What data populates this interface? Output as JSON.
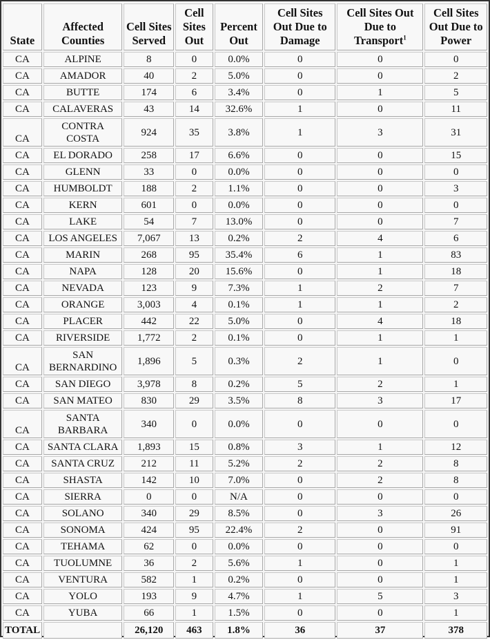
{
  "table": {
    "headers": [
      "State",
      "Affected Counties",
      "Cell Sites Served",
      "Cell Sites Out",
      "Percent Out",
      "Cell Sites Out Due to Damage",
      "Cell Sites Out Due to Transport",
      "Cell Sites Out Due to Power"
    ],
    "transport_footnote": "1",
    "rows": [
      [
        "CA",
        "ALPINE",
        "8",
        "0",
        "0.0%",
        "0",
        "0",
        "0"
      ],
      [
        "CA",
        "AMADOR",
        "40",
        "2",
        "5.0%",
        "0",
        "0",
        "2"
      ],
      [
        "CA",
        "BUTTE",
        "174",
        "6",
        "3.4%",
        "0",
        "1",
        "5"
      ],
      [
        "CA",
        "CALAVERAS",
        "43",
        "14",
        "32.6%",
        "1",
        "0",
        "11"
      ],
      [
        "CA",
        "CONTRA COSTA",
        "924",
        "35",
        "3.8%",
        "1",
        "3",
        "31"
      ],
      [
        "CA",
        "EL DORADO",
        "258",
        "17",
        "6.6%",
        "0",
        "0",
        "15"
      ],
      [
        "CA",
        "GLENN",
        "33",
        "0",
        "0.0%",
        "0",
        "0",
        "0"
      ],
      [
        "CA",
        "HUMBOLDT",
        "188",
        "2",
        "1.1%",
        "0",
        "0",
        "3"
      ],
      [
        "CA",
        "KERN",
        "601",
        "0",
        "0.0%",
        "0",
        "0",
        "0"
      ],
      [
        "CA",
        "LAKE",
        "54",
        "7",
        "13.0%",
        "0",
        "0",
        "7"
      ],
      [
        "CA",
        "LOS ANGELES",
        "7,067",
        "13",
        "0.2%",
        "2",
        "4",
        "6"
      ],
      [
        "CA",
        "MARIN",
        "268",
        "95",
        "35.4%",
        "6",
        "1",
        "83"
      ],
      [
        "CA",
        "NAPA",
        "128",
        "20",
        "15.6%",
        "0",
        "1",
        "18"
      ],
      [
        "CA",
        "NEVADA",
        "123",
        "9",
        "7.3%",
        "1",
        "2",
        "7"
      ],
      [
        "CA",
        "ORANGE",
        "3,003",
        "4",
        "0.1%",
        "1",
        "1",
        "2"
      ],
      [
        "CA",
        "PLACER",
        "442",
        "22",
        "5.0%",
        "0",
        "4",
        "18"
      ],
      [
        "CA",
        "RIVERSIDE",
        "1,772",
        "2",
        "0.1%",
        "0",
        "1",
        "1"
      ],
      [
        "CA",
        "SAN BERNARDINO",
        "1,896",
        "5",
        "0.3%",
        "2",
        "1",
        "0"
      ],
      [
        "CA",
        "SAN DIEGO",
        "3,978",
        "8",
        "0.2%",
        "5",
        "2",
        "1"
      ],
      [
        "CA",
        "SAN MATEO",
        "830",
        "29",
        "3.5%",
        "8",
        "3",
        "17"
      ],
      [
        "CA",
        "SANTA BARBARA",
        "340",
        "0",
        "0.0%",
        "0",
        "0",
        "0"
      ],
      [
        "CA",
        "SANTA CLARA",
        "1,893",
        "15",
        "0.8%",
        "3",
        "1",
        "12"
      ],
      [
        "CA",
        "SANTA CRUZ",
        "212",
        "11",
        "5.2%",
        "2",
        "2",
        "8"
      ],
      [
        "CA",
        "SHASTA",
        "142",
        "10",
        "7.0%",
        "0",
        "2",
        "8"
      ],
      [
        "CA",
        "SIERRA",
        "0",
        "0",
        "N/A",
        "0",
        "0",
        "0"
      ],
      [
        "CA",
        "SOLANO",
        "340",
        "29",
        "8.5%",
        "0",
        "3",
        "26"
      ],
      [
        "CA",
        "SONOMA",
        "424",
        "95",
        "22.4%",
        "2",
        "0",
        "91"
      ],
      [
        "CA",
        "TEHAMA",
        "62",
        "0",
        "0.0%",
        "0",
        "0",
        "0"
      ],
      [
        "CA",
        "TUOLUMNE",
        "36",
        "2",
        "5.6%",
        "1",
        "0",
        "1"
      ],
      [
        "CA",
        "VENTURA",
        "582",
        "1",
        "0.2%",
        "0",
        "0",
        "1"
      ],
      [
        "CA",
        "YOLO",
        "193",
        "9",
        "4.7%",
        "1",
        "5",
        "3"
      ],
      [
        "CA",
        "YUBA",
        "66",
        "1",
        "1.5%",
        "0",
        "0",
        "1"
      ]
    ],
    "total": [
      "TOTAL",
      "",
      "26,120",
      "463",
      "1.8%",
      "36",
      "37",
      "378"
    ]
  }
}
